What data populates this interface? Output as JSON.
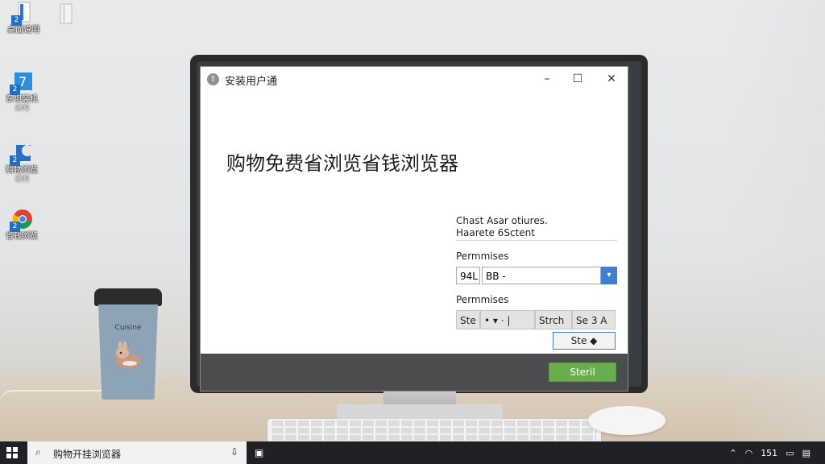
{
  "desktop": {
    "icons": [
      {
        "label": "桌面说明",
        "sub": "",
        "badge": "2"
      },
      {
        "label": "",
        "sub": "",
        "badge": ""
      },
      {
        "label": "东坝装机",
        "sub": "说明",
        "badge": "2"
      },
      {
        "label": "购物浏览",
        "sub": "说明",
        "badge": "2"
      },
      {
        "label": "省钱浏览",
        "sub": "",
        "badge": "2"
      }
    ],
    "cup_text": "Cuisine"
  },
  "installer": {
    "title": "安装用户通",
    "headline": "购物免费省浏览省钱浏览器",
    "panel_line1": "Chast Asar otiures.",
    "panel_line2": "Haarete 6Sctent",
    "perm_label_1": "Permmises",
    "field_short": "94L",
    "field_value": "BB -",
    "perm_label_2": "Permmises",
    "seg_1": "Ste",
    "seg_2": "• ▾ · |",
    "seg_3": "Strch",
    "seg_4": "Se 3 A",
    "save_button": "Ste ◆",
    "install_button": "Steril",
    "minimize": "–",
    "maximize": "☐",
    "close": "✕"
  },
  "taskbar": {
    "search_text": "购物开挂浏览器",
    "tray_time": "151",
    "icons": {
      "start": "windows-logo",
      "search": "search-icon",
      "mic": "mic-icon",
      "wifi": "wifi-icon",
      "volume": "volume-icon",
      "battery": "battery-icon",
      "notifications": "notification-icon"
    }
  },
  "colors": {
    "accent_blue": "#3f7fd1",
    "install_green": "#6aad4d",
    "footer_dark": "#4a4c4e",
    "taskbar": "#202124"
  }
}
